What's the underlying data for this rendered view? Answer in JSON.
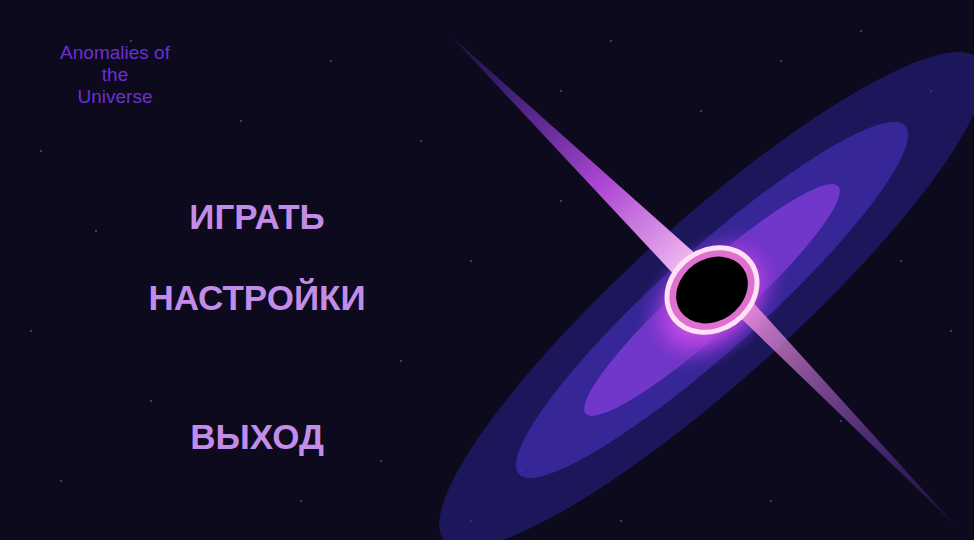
{
  "game": {
    "title_lines": [
      "Anomalies of",
      "the",
      "Universe"
    ]
  },
  "menu": {
    "items": [
      {
        "label": "ИГРАТЬ"
      },
      {
        "label": "НАСТРОЙКИ"
      },
      {
        "label": "ВЫХОД"
      }
    ]
  }
}
